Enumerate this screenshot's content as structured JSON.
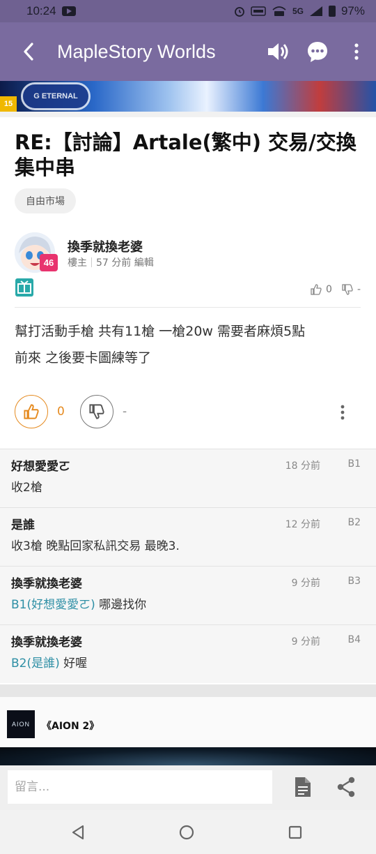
{
  "status_bar": {
    "time": "10:24",
    "battery": "97%",
    "network": "5G",
    "icons": [
      "youtube-icon",
      "alarm-icon",
      "volte-icon",
      "wifi-call-icon",
      "signal-icon",
      "battery-icon"
    ]
  },
  "app_bar": {
    "title": "MapleStory Worlds",
    "icons": [
      "back-arrow-icon",
      "speaker-icon",
      "chat-bubble-icon",
      "more-vertical-icon"
    ]
  },
  "banner": {
    "badge": "15",
    "logo": "G ETERNAL"
  },
  "post": {
    "title": "RE:【討論】Artale(繁中) 交易/交換集中串",
    "category": "自由市場",
    "author": "換季就換老婆",
    "author_level": "46",
    "role": "樓主",
    "time": "57 分前 編輯",
    "mini_up": "0",
    "mini_down": "-",
    "body_line1": "幫打活動手槍 共有11槍  一槍20w 需要者麻煩5點",
    "body_line2": "前來 之後要卡圖練等了",
    "up_count": "0",
    "down_count": "-"
  },
  "comments": [
    {
      "name": "好想愛愛ㄛ",
      "time": "18 分前",
      "floor": "B1",
      "ref": "",
      "text": "收2槍"
    },
    {
      "name": "是誰",
      "time": "12 分前",
      "floor": "B2",
      "ref": "",
      "text": "收3槍 晚點回家私訊交易 最晚3."
    },
    {
      "name": "換季就換老婆",
      "time": "9 分前",
      "floor": "B3",
      "ref": "B1(好想愛愛ㄛ)",
      "text": " 哪邊找你"
    },
    {
      "name": "換季就換老婆",
      "time": "9 分前",
      "floor": "B4",
      "ref": "B2(是誰)",
      "text": " 好喔"
    }
  ],
  "ad": {
    "logo": "AION",
    "title": "《AION 2》"
  },
  "reply": {
    "placeholder": "留言..."
  },
  "colors": {
    "app_bar": "#7a6b9f",
    "status_bar": "#6f6191",
    "accent_orange": "#e58a1f",
    "reply_ref": "#2e8fa5",
    "level_badge": "#e8336e"
  }
}
